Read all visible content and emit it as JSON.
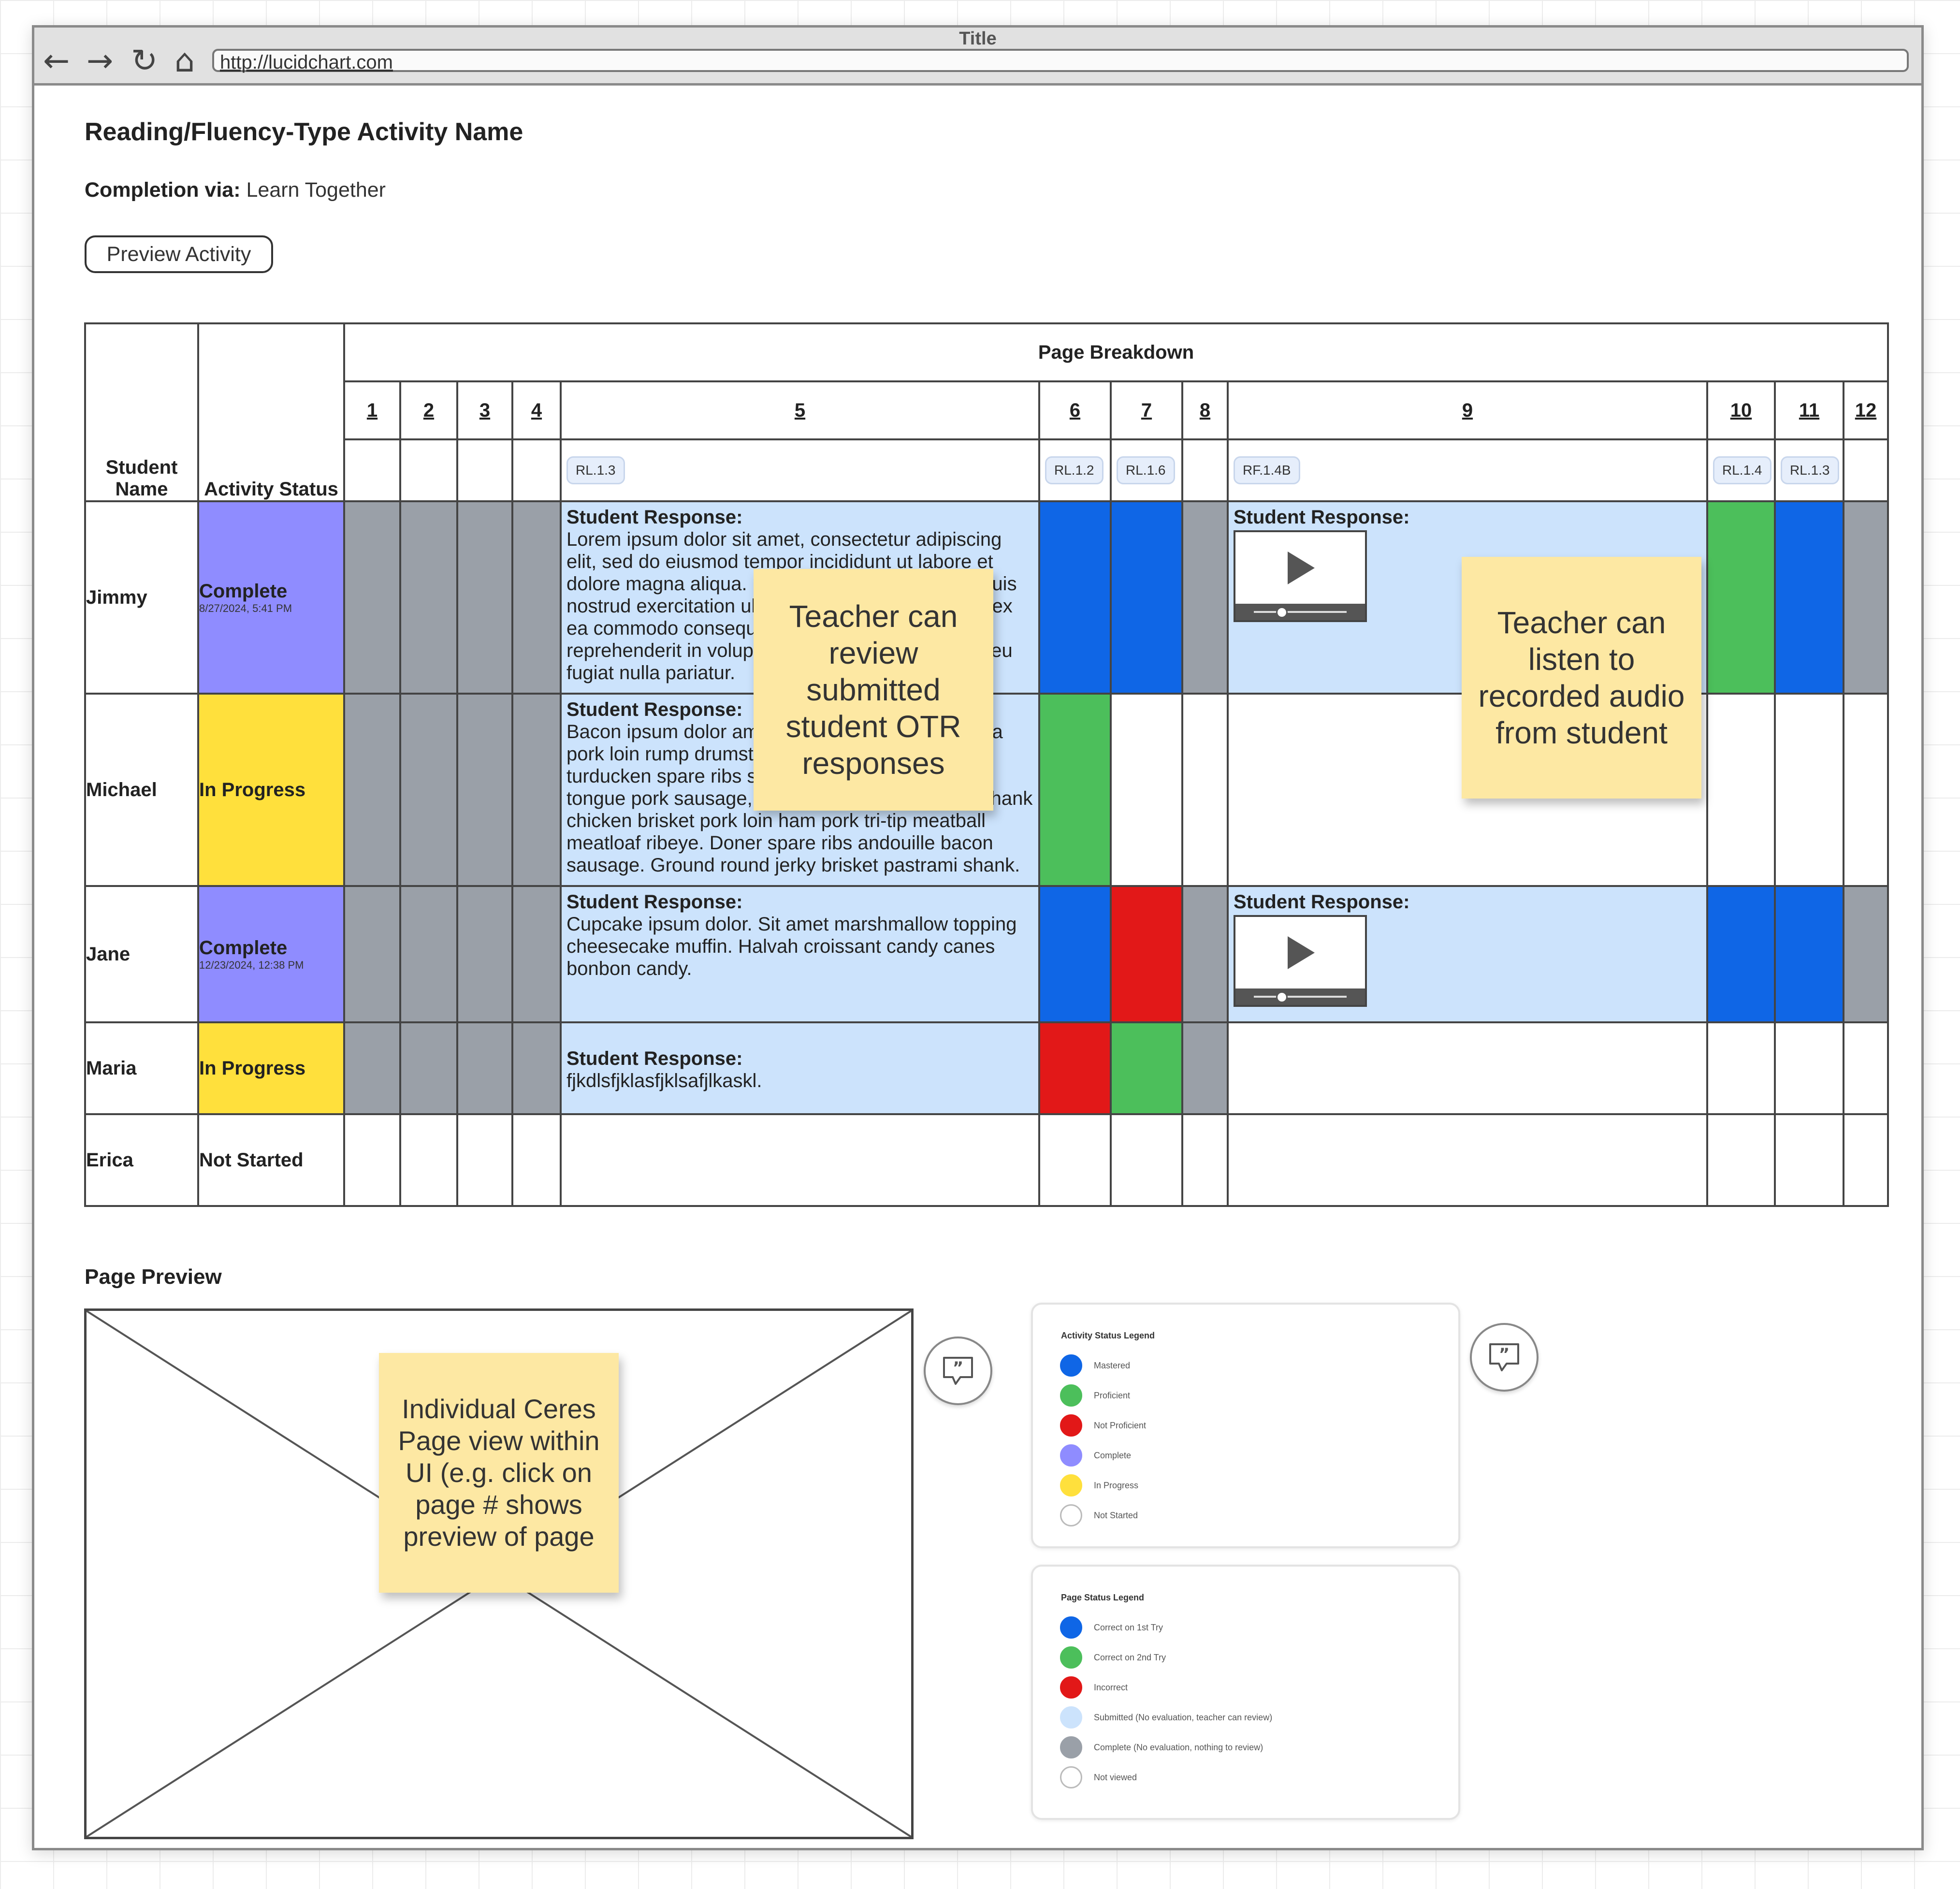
{
  "window": {
    "title": "Title",
    "url": "http://lucidchart.com"
  },
  "header": {
    "activity_name": "Reading/Fluency-Type Activity Name",
    "completion_label": "Completion via:",
    "completion_value": "Learn Together",
    "preview_button": "Preview Activity"
  },
  "table": {
    "col_student": "Student Name",
    "col_status": "Activity Status",
    "page_breakdown": "Page Breakdown",
    "pages": [
      "1",
      "2",
      "3",
      "4",
      "5",
      "6",
      "7",
      "8",
      "9",
      "10",
      "11",
      "12"
    ],
    "standards": {
      "p5": "RL.1.3",
      "p6": "RL.1.2",
      "p7": "RL.1.6",
      "p9": "RF.1.4B",
      "p10": "RL.1.4",
      "p11": "RL.1.3"
    },
    "rows": [
      {
        "name": "Jimmy",
        "status": "Complete",
        "date": "8/27/2024, 5:41 PM",
        "p5_label": "Student Response:",
        "p5_text": "Lorem ipsum dolor sit amet, consectetur adipiscing elit, sed do eiusmod tempor incididunt ut labore et dolore magna aliqua. Ut enim ad minim veniam, quis nostrud exercitation ullamco laboris nisi ut aliquip ex ea commodo consequat. Duis aute irure dolor in reprehenderit in voluptate velit esse cillum dolore eu fugiat nulla pariatur.",
        "p9_label": "Student Response:"
      },
      {
        "name": "Michael",
        "status": "In Progress",
        "p5_label": "Student Response:",
        "p5_text": "Bacon ipsum dolor amet beef ribs shankle kielbasa pork loin rump drumstick pig sirloin frankfurter turducken spare ribs salami picanha doner jowl tongue pork sausage, buffalo bresaola venison. Shank chicken brisket pork loin ham pork tri-tip meatball meatloaf ribeye. Doner spare ribs andouille bacon sausage. Ground round jerky brisket pastrami shank."
      },
      {
        "name": "Jane",
        "status": "Complete",
        "date": "12/23/2024, 12:38 PM",
        "p5_label": "Student Response:",
        "p5_text": "Cupcake ipsum dolor. Sit amet marshmallow topping cheesecake muffin. Halvah croissant candy canes bonbon candy.",
        "p9_label": "Student Response:"
      },
      {
        "name": "Maria",
        "status": "In Progress",
        "p5_label": "Student Response:",
        "p5_text": "fjkdlsfjklasfjklsafjlkaskl."
      },
      {
        "name": "Erica",
        "status": "Not Started"
      }
    ]
  },
  "stickies": {
    "otr": "Teacher can review submitted student OTR responses",
    "audio": "Teacher can listen to recorded audio from student",
    "preview": "Individual Ceres Page view within UI (e.g. click on page # shows preview of page"
  },
  "page_preview": {
    "label": "Page Preview"
  },
  "activity_legend": {
    "title": "Activity Status Legend",
    "items": [
      {
        "label": "Mastered",
        "color": "#0f66e6"
      },
      {
        "label": "Proficient",
        "color": "#4cbf5b"
      },
      {
        "label": "Not Proficient",
        "color": "#e21818"
      },
      {
        "label": "Complete",
        "color": "#8f8cff"
      },
      {
        "label": "In Progress",
        "color": "#ffe03c"
      },
      {
        "label": "Not Started",
        "color": "#ffffff"
      }
    ]
  },
  "page_legend": {
    "title": "Page Status Legend",
    "items": [
      {
        "label": "Correct on 1st Try",
        "color": "#0f66e6"
      },
      {
        "label": "Correct on 2nd Try",
        "color": "#4cbf5b"
      },
      {
        "label": "Incorrect",
        "color": "#e21818"
      },
      {
        "label": "Submitted (No evaluation, teacher can review)",
        "color": "#cce3fc"
      },
      {
        "label": "Complete (No evaluation, nothing to review)",
        "color": "#9aa0a8"
      },
      {
        "label": "Not viewed",
        "color": "#ffffff"
      }
    ]
  },
  "colors": {
    "complete": "#8f8cff",
    "in_progress": "#ffe03c",
    "correct_1st": "#0f66e6",
    "correct_2nd": "#4cbf5b",
    "incorrect": "#e21818",
    "submitted": "#cce3fc",
    "complete_no_eval": "#9aa0a8",
    "sticky": "#fde8a3"
  }
}
